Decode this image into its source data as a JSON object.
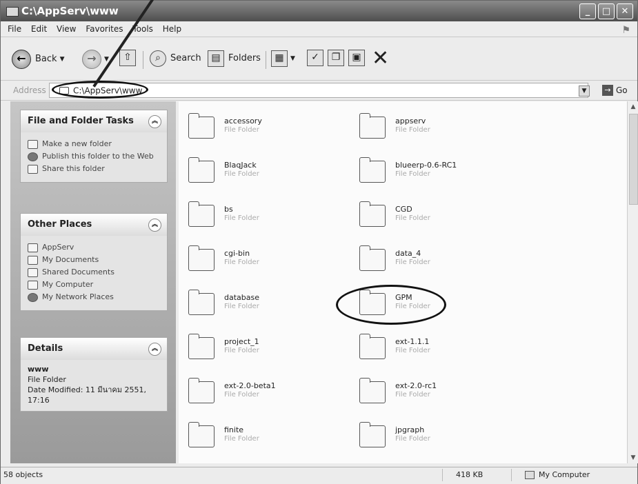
{
  "window": {
    "title": "C:\\AppServ\\www"
  },
  "menu": [
    "File",
    "Edit",
    "View",
    "Favorites",
    "Tools",
    "Help"
  ],
  "toolbar": {
    "back": "Back",
    "search": "Search",
    "folders": "Folders"
  },
  "address": {
    "label": "Address",
    "value": "C:\\AppServ\\www",
    "go": "Go"
  },
  "panels": {
    "file_tasks": {
      "title": "File and Folder Tasks",
      "items": [
        "Make a new folder",
        "Publish this folder to the Web",
        "Share this folder"
      ]
    },
    "other_places": {
      "title": "Other Places",
      "items": [
        "AppServ",
        "My Documents",
        "Shared Documents",
        "My Computer",
        "My Network Places"
      ]
    },
    "details": {
      "title": "Details",
      "name": "www",
      "type": "File Folder",
      "modified": "Date Modified: 11 มีนาคม 2551, 17:16"
    }
  },
  "files": [
    {
      "name": "accessory",
      "type": "File Folder"
    },
    {
      "name": "appserv",
      "type": "File Folder"
    },
    {
      "name": "BlaqJack",
      "type": "File Folder"
    },
    {
      "name": "blueerp-0.6-RC1",
      "type": "File Folder"
    },
    {
      "name": "bs",
      "type": "File Folder"
    },
    {
      "name": "CGD",
      "type": "File Folder"
    },
    {
      "name": "cgi-bin",
      "type": "File Folder"
    },
    {
      "name": "data_4",
      "type": "File Folder"
    },
    {
      "name": "database",
      "type": "File Folder"
    },
    {
      "name": "GPM",
      "type": "File Folder"
    },
    {
      "name": "project_1",
      "type": "File Folder"
    },
    {
      "name": "ext-1.1.1",
      "type": "File Folder"
    },
    {
      "name": "ext-2.0-beta1",
      "type": "File Folder"
    },
    {
      "name": "ext-2.0-rc1",
      "type": "File Folder"
    },
    {
      "name": "finite",
      "type": "File Folder"
    },
    {
      "name": "jpgraph",
      "type": "File Folder"
    }
  ],
  "status": {
    "count": "58 objects",
    "size": "418 KB",
    "location": "My Computer"
  }
}
